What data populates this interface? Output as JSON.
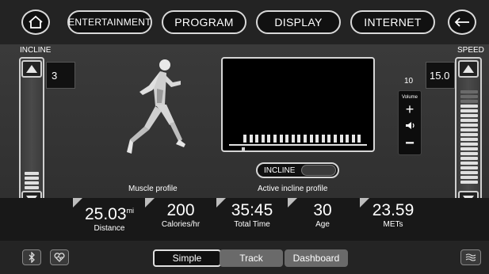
{
  "nav": {
    "home_icon": "home-icon",
    "entertainment": "ENTERTAINMENT",
    "program": "PROGRAM",
    "display": "DISPLAY",
    "internet": "INTERNET",
    "back_icon": "back-arrow-icon"
  },
  "incline": {
    "label": "INCLINE",
    "value": "3"
  },
  "speed": {
    "label": "SPEED",
    "value": "15.0"
  },
  "volume": {
    "value": "10",
    "label": "Volume",
    "plus": "+",
    "minus": "−"
  },
  "muscle_profile": {
    "caption": "Muscle profile"
  },
  "incline_profile": {
    "toggle_label": "INCLINE",
    "caption": "Active incline profile"
  },
  "stats": [
    {
      "value": "25.03",
      "unit": "mi",
      "label": "Distance"
    },
    {
      "value": "200",
      "unit": "",
      "label": "Calories/hr"
    },
    {
      "value": "35:45",
      "unit": "",
      "label": "Total Time"
    },
    {
      "value": "30",
      "unit": "",
      "label": "Age"
    },
    {
      "value": "23.59",
      "unit": "",
      "label": "METs"
    }
  ],
  "bottom": {
    "bluetooth_icon": "bluetooth-icon",
    "heart_icon": "heart-rate-icon",
    "tabs": [
      "Simple",
      "Track",
      "Dashboard"
    ],
    "fan_icon": "fan-icon"
  },
  "colors": {
    "background": "#1b1b1b",
    "accent": "#e0e0e0"
  }
}
